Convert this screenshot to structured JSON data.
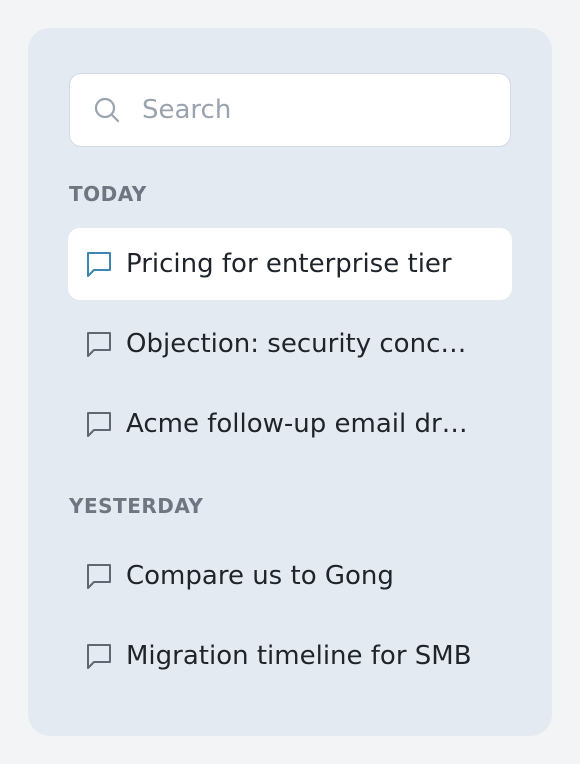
{
  "search": {
    "placeholder": "Search",
    "icon": "search-icon"
  },
  "sections": [
    {
      "label": "TODAY",
      "items": [
        {
          "label": "Pricing for enterprise tier",
          "icon": "chat-bubble-icon",
          "active": true
        },
        {
          "label": "Objection: security conc…",
          "icon": "chat-bubble-icon",
          "active": false
        },
        {
          "label": "Acme follow-up email dr…",
          "icon": "chat-bubble-icon",
          "active": false
        }
      ]
    },
    {
      "label": "YESTERDAY",
      "items": [
        {
          "label": "Compare us to Gong",
          "icon": "chat-bubble-icon",
          "active": false
        },
        {
          "label": "Migration timeline for SMB",
          "icon": "chat-bubble-icon",
          "active": false
        }
      ]
    }
  ],
  "colors": {
    "panel_background": "#e4eaf1",
    "active_item_background": "#ffffff",
    "active_icon": "#3b86b3",
    "inactive_icon": "#5f6873",
    "section_label": "#6e7781"
  }
}
